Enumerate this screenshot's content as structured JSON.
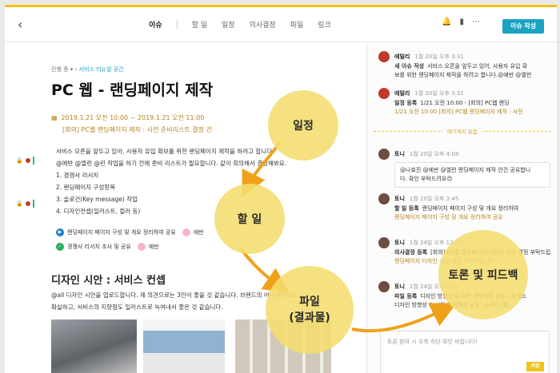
{
  "header": {
    "back_label": "‹",
    "tabs": [
      "이슈",
      "할 일",
      "일정",
      "의사결정",
      "파일",
      "링크"
    ],
    "active_tab": "이슈",
    "icons": [
      "bell-icon",
      "bookmark-icon",
      "more-icon"
    ],
    "new_button": "이슈 작성"
  },
  "issue": {
    "status": "진행 중 ▾",
    "space": "서비스 리뉴얼 공간",
    "title": "PC 웹 - 랜딩페이지 제작",
    "schedule_time": "2019.1.21 오전 10:00 ~ 2019.1.21 오전 11:00",
    "schedule_name": "[회의] PC웹 랜딩페이지 제작 : 사전 준비리스트 결정 건",
    "body": [
      "서비스 오픈을 앞두고 있어, 사용자 유입 확보를 위한 랜딩페이지 제작을 하려고 합니다.",
      "@에반 @엘런 @린 작업을 하기 전에 준비 리스트가 필요합니다. 같이 회의해서 결정해봐요.",
      "1. 경쟁사 리서치",
      "2. 랜딩페이지 구성항목",
      "3. 슬로건(Key message) 작업",
      "4. 디자인컨셉(일러스트, 컬러 등)"
    ],
    "tasks": [
      {
        "label": "랜딩페이지 페이지 구성 및 개요 정리하여 공유",
        "assignee": "에반"
      },
      {
        "label": "경쟁사 리서치 조사 및 공유",
        "assignee": "예반"
      }
    ],
    "section_title": "디자인 시안 : 서비스 컨셉",
    "section_body": [
      "@all 디자인 시안을 업로드합니다. 제 의견으로는 3안이 좋을 것 같습니다. 브랜드의 아이덴티티도",
      "확실하고, 서비스의 지향점도 일러스트로 녹여내서 좋은 것 같습니다."
    ]
  },
  "feed": {
    "items": [
      {
        "name": "에밀리",
        "time": "1월 20일 오후 3:31",
        "kind": "새 이슈 작성",
        "text": "서비스 오픈을 앞두고 있어, 사용자 유입 확",
        "text2": "보를 위한 랜딩페이지 제작을 하려고 합니다.@에반 @엘런"
      },
      {
        "name": "에밀리",
        "time": "1월 20일 오후 3:31",
        "kind": "일정 등록",
        "text": "1/21 오전 10:00 - [회의] PC웹 랜딩",
        "text2": "1/21 오전 10:00 [회의] PC웹 랜딩페이지 제작 : 사전"
      },
      {
        "name": "토니",
        "time": "1월 20일 오후 4:08",
        "bubble1": "@나효진 @에반 @엘런 랜딩페이지 제작 안건 공유합니",
        "bubble2": "다. 확인 부탁드려요😊"
      },
      {
        "name": "토니",
        "time": "1월 20일 오후 3:45",
        "kind": "할 일 등록",
        "text": "랜딩페이지 페이지 구성 및 개요 정리하여",
        "text2": "랜딩페이지 페이지 구성 및 개요 정리하여 공유"
      },
      {
        "name": "토니",
        "time": "1월 24일 오후 12:30",
        "kind": "의사결정 등록",
        "text": "[회의] PC웹 랜딩페이지 디자인 시안 결정 부탁드립니",
        "text2": "랜딩페이지 디자인 시안 결정 부탁드립니다"
      },
      {
        "name": "토니",
        "time": "1월 24일 오후 3:12",
        "kind": "파일 등록",
        "text": "디자인 방향성 & 시안 제작하여 공유 - 브랜드",
        "text2": "디자인 방향성 & 시안 제작하여 공유 - 브랜드 필..."
      }
    ],
    "divider_label": "여기까지 읽음",
    "compose_hint": "토론 참여 시 우측 하단 확인 바랍니다!",
    "save_label": "저장"
  },
  "overlay": {
    "labels": [
      "일정",
      "할 일",
      "파일\n(결과물)",
      "토론 및 피드백"
    ],
    "accent": "#f4dd6e",
    "arrow_color": "#f0a11a"
  }
}
